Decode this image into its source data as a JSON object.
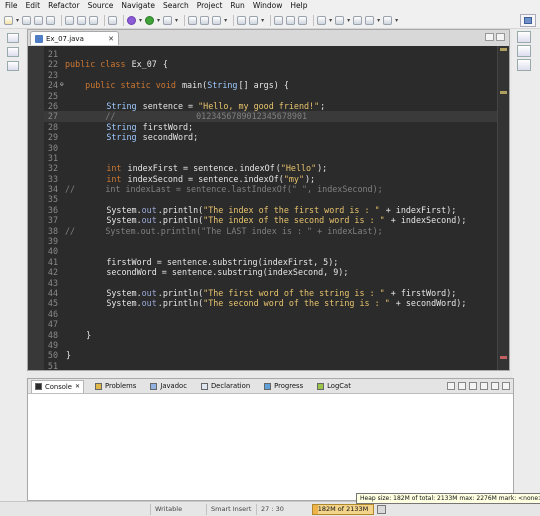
{
  "menu": [
    "File",
    "Edit",
    "Refactor",
    "Source",
    "Navigate",
    "Search",
    "Project",
    "Run",
    "Window",
    "Help"
  ],
  "editor": {
    "tab_label": "Ex_07.java",
    "lines": [
      {
        "n": "21",
        "fold": "",
        "segs": [
          {
            "t": "",
            "c": "txt"
          }
        ]
      },
      {
        "n": "22",
        "fold": "",
        "segs": [
          {
            "t": "public class ",
            "c": "kw"
          },
          {
            "t": "Ex_07 ",
            "c": "txt"
          },
          {
            "t": "{",
            "c": "txt"
          }
        ]
      },
      {
        "n": "23",
        "fold": "",
        "segs": [
          {
            "t": "",
            "c": "txt"
          }
        ]
      },
      {
        "n": "24",
        "fold": "⊖",
        "segs": [
          {
            "t": "    public static void ",
            "c": "kw"
          },
          {
            "t": "main(",
            "c": "txt"
          },
          {
            "t": "String",
            "c": "typ"
          },
          {
            "t": "[] args) {",
            "c": "txt"
          }
        ]
      },
      {
        "n": "25",
        "fold": "",
        "segs": [
          {
            "t": "",
            "c": "txt"
          }
        ]
      },
      {
        "n": "26",
        "fold": "",
        "segs": [
          {
            "t": "        ",
            "c": "txt"
          },
          {
            "t": "String",
            "c": "typ"
          },
          {
            "t": " sentence = ",
            "c": "txt"
          },
          {
            "t": "\"Hello, my good friend!\"",
            "c": "str"
          },
          {
            "t": ";",
            "c": "txt"
          }
        ]
      },
      {
        "n": "27",
        "fold": "",
        "cur": true,
        "segs": [
          {
            "t": "        //                ",
            "c": "cm"
          },
          {
            "t": "0123456789012345678901",
            "c": "cm"
          }
        ]
      },
      {
        "n": "28",
        "fold": "",
        "segs": [
          {
            "t": "        ",
            "c": "txt"
          },
          {
            "t": "String",
            "c": "typ"
          },
          {
            "t": " firstWord;",
            "c": "txt"
          }
        ]
      },
      {
        "n": "29",
        "fold": "",
        "segs": [
          {
            "t": "        ",
            "c": "txt"
          },
          {
            "t": "String",
            "c": "typ"
          },
          {
            "t": " secondWord;",
            "c": "txt"
          }
        ]
      },
      {
        "n": "30",
        "fold": "",
        "segs": [
          {
            "t": "",
            "c": "txt"
          }
        ]
      },
      {
        "n": "31",
        "fold": "",
        "segs": [
          {
            "t": "",
            "c": "txt"
          }
        ]
      },
      {
        "n": "32",
        "fold": "",
        "segs": [
          {
            "t": "        ",
            "c": "txt"
          },
          {
            "t": "int",
            "c": "kw"
          },
          {
            "t": " indexFirst = sentence.",
            "c": "txt"
          },
          {
            "t": "indexOf",
            "c": "txt"
          },
          {
            "t": "(",
            "c": "txt"
          },
          {
            "t": "\"Hello\"",
            "c": "str"
          },
          {
            "t": ");",
            "c": "txt"
          }
        ]
      },
      {
        "n": "33",
        "fold": "",
        "segs": [
          {
            "t": "        ",
            "c": "txt"
          },
          {
            "t": "int",
            "c": "kw"
          },
          {
            "t": " indexSecond = sentence.indexOf(",
            "c": "txt"
          },
          {
            "t": "\"my\"",
            "c": "str"
          },
          {
            "t": ");",
            "c": "txt"
          }
        ]
      },
      {
        "n": "34",
        "fold": "",
        "segs": [
          {
            "t": "//      int indexLast = sentence.lastIndexOf(\" \", indexSecond);",
            "c": "cm"
          }
        ]
      },
      {
        "n": "35",
        "fold": "",
        "segs": [
          {
            "t": "",
            "c": "txt"
          }
        ]
      },
      {
        "n": "36",
        "fold": "",
        "segs": [
          {
            "t": "        System.",
            "c": "txt"
          },
          {
            "t": "out",
            "c": "fld"
          },
          {
            "t": ".println(",
            "c": "txt"
          },
          {
            "t": "\"The index of the first word is : \"",
            "c": "str"
          },
          {
            "t": " + indexFirst);",
            "c": "txt"
          }
        ]
      },
      {
        "n": "37",
        "fold": "",
        "segs": [
          {
            "t": "        System.",
            "c": "txt"
          },
          {
            "t": "out",
            "c": "fld"
          },
          {
            "t": ".println(",
            "c": "txt"
          },
          {
            "t": "\"The index of the second word is : \"",
            "c": "str"
          },
          {
            "t": " + indexSecond);",
            "c": "txt"
          }
        ]
      },
      {
        "n": "38",
        "fold": "",
        "segs": [
          {
            "t": "//      System.out.println(\"The LAST index is : \" + indexLast);",
            "c": "cm"
          }
        ]
      },
      {
        "n": "39",
        "fold": "",
        "segs": [
          {
            "t": "",
            "c": "txt"
          }
        ]
      },
      {
        "n": "40",
        "fold": "",
        "segs": [
          {
            "t": "",
            "c": "txt"
          }
        ]
      },
      {
        "n": "41",
        "fold": "",
        "segs": [
          {
            "t": "        firstWord = sentence.substring(indexFirst, 5);",
            "c": "txt"
          }
        ]
      },
      {
        "n": "42",
        "fold": "",
        "segs": [
          {
            "t": "        secondWord = sentence.substring(indexSecond, 9);",
            "c": "txt"
          }
        ]
      },
      {
        "n": "43",
        "fold": "",
        "segs": [
          {
            "t": "",
            "c": "txt"
          }
        ]
      },
      {
        "n": "44",
        "fold": "",
        "segs": [
          {
            "t": "        System.",
            "c": "txt"
          },
          {
            "t": "out",
            "c": "fld"
          },
          {
            "t": ".println(",
            "c": "txt"
          },
          {
            "t": "\"The first word of the string is : \"",
            "c": "str"
          },
          {
            "t": " + firstWord);",
            "c": "txt"
          }
        ]
      },
      {
        "n": "45",
        "fold": "",
        "segs": [
          {
            "t": "        System.",
            "c": "txt"
          },
          {
            "t": "out",
            "c": "fld"
          },
          {
            "t": ".println(",
            "c": "txt"
          },
          {
            "t": "\"The second word of the string is : \"",
            "c": "str"
          },
          {
            "t": " + secondWord);",
            "c": "txt"
          }
        ]
      },
      {
        "n": "46",
        "fold": "",
        "segs": [
          {
            "t": "",
            "c": "txt"
          }
        ]
      },
      {
        "n": "47",
        "fold": "",
        "segs": [
          {
            "t": "",
            "c": "txt"
          }
        ]
      },
      {
        "n": "48",
        "fold": "",
        "segs": [
          {
            "t": "    }",
            "c": "txt"
          }
        ]
      },
      {
        "n": "49",
        "fold": "",
        "segs": [
          {
            "t": "",
            "c": "txt"
          }
        ]
      },
      {
        "n": "50",
        "fold": "",
        "segs": [
          {
            "t": "}",
            "c": "txt"
          }
        ]
      },
      {
        "n": "51",
        "fold": "",
        "segs": [
          {
            "t": "",
            "c": "txt"
          }
        ]
      }
    ]
  },
  "bottom_tabs": [
    {
      "label": "Console",
      "icon": "console-icon",
      "active": true
    },
    {
      "label": "Problems",
      "icon": "problems-icon"
    },
    {
      "label": "Javadoc",
      "icon": "javadoc-icon"
    },
    {
      "label": "Declaration",
      "icon": "declaration-icon"
    },
    {
      "label": "Progress",
      "icon": "progress-icon"
    },
    {
      "label": "LogCat",
      "icon": "logcat-icon"
    }
  ],
  "status": {
    "field1": "Writable",
    "field2": "Smart Insert",
    "field3": "27 : 30",
    "heap_label": "182M of 2133M",
    "heap_fraction": 0.085
  },
  "tooltip": "Heap size: 182M of total: 2133M max: 2276M mark: <none>"
}
